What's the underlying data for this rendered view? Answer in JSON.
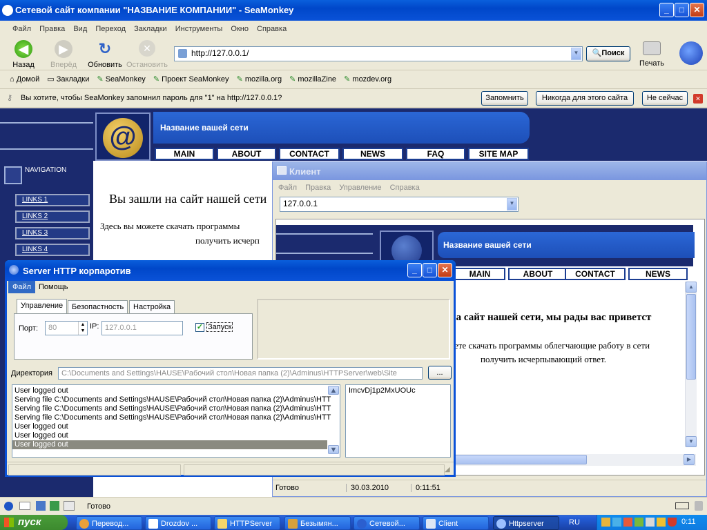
{
  "browser": {
    "title": "Сетевой сайт компании \"НАЗВАНИЕ КОМПАНИИ\" - SeaMonkey",
    "menu": [
      "Файл",
      "Правка",
      "Вид",
      "Переход",
      "Закладки",
      "Инструменты",
      "Окно",
      "Справка"
    ],
    "nav": {
      "back": "Назад",
      "forward": "Вперёд",
      "reload": "Обновить",
      "stop": "Остановить",
      "search": "Поиск",
      "print": "Печать"
    },
    "url": "http://127.0.0.1/",
    "bookmarks": [
      "Домой",
      "Закладки",
      "SeaMonkey",
      "Проект SeaMonkey",
      "mozilla.org",
      "mozillaZine",
      "mozdev.org"
    ],
    "password_bar": {
      "text": "Вы хотите, чтобы SeaMonkey запомнил пароль для \"1\" на http://127.0.0.1?",
      "remember": "Запомнить",
      "never": "Никогда для этого сайта",
      "not_now": "Не сейчас"
    },
    "status": "Готово"
  },
  "site": {
    "network_name": "Название вашей сети",
    "nav": [
      "MAIN",
      "ABOUT",
      "CONTACT",
      "NEWS",
      "FAQ",
      "SITE MAP"
    ],
    "sidebar_title": "NAVIGATION",
    "links": [
      "LINKS 1",
      "LINKS 2",
      "LINKS 3",
      "LINKS 4"
    ],
    "welcome": "Вы зашли на сайт нашей сети",
    "body1": "Здесь вы можете скачать программы",
    "body2": "получить исчерп"
  },
  "client": {
    "title": "Клиент",
    "menu": [
      "Файл",
      "Правка",
      "Управление",
      "Справка"
    ],
    "address": "127.0.0.1",
    "network_name": "Название вашей сети",
    "nav": [
      "MAIN",
      "ABOUT",
      "CONTACT",
      "NEWS"
    ],
    "welcome": "на сайт нашей сети, мы рады вас приветст",
    "body1": "ете скачать программы облегчающие работу в сети",
    "body2": "получить исчерпывающий ответ.",
    "status": {
      "ready": "Готово",
      "date": "30.03.2010",
      "time": "0:11:51"
    }
  },
  "server": {
    "title": "Server HTTP корпаротив",
    "menu": [
      "Файл",
      "Помощь"
    ],
    "tabs": [
      "Управление",
      "Безопастность",
      "Настройка"
    ],
    "port_label": "Порт:",
    "port": "80",
    "ip_label": "IP:",
    "ip": "127.0.0.1",
    "start_label": "Запуск",
    "dir_label": "Директория",
    "dir": "C:\\Documents and Settings\\HAUSE\\Рабочий стол\\Новая папка (2)\\Adminus\\HTTPServer\\web\\Site",
    "browse": "...",
    "log": [
      "User logged out",
      "Serving file C:\\Documents and Settings\\HAUSE\\Рабочий стол\\Новая папка (2)\\Adminus\\HTT",
      "Serving file C:\\Documents and Settings\\HAUSE\\Рабочий стол\\Новая папка (2)\\Adminus\\HTT",
      "Serving file C:\\Documents and Settings\\HAUSE\\Рабочий стол\\Новая папка (2)\\Adminus\\HTT",
      "User logged out",
      "User logged out",
      "User logged out"
    ],
    "session_id": "ImcvDj1p2MxUOUc"
  },
  "taskbar": {
    "start": "пуск",
    "items": [
      "Перевод...",
      "Drozdov ...",
      "HTTPServer",
      "Безымян...",
      "Сетевой...",
      "Client",
      "Httpserver"
    ],
    "lang": "RU",
    "clock": "0:11"
  },
  "colors": {
    "site_dark": "#1b2a6e",
    "site_blue": "#1d55c6",
    "xp_blue": "#0a52d8"
  }
}
